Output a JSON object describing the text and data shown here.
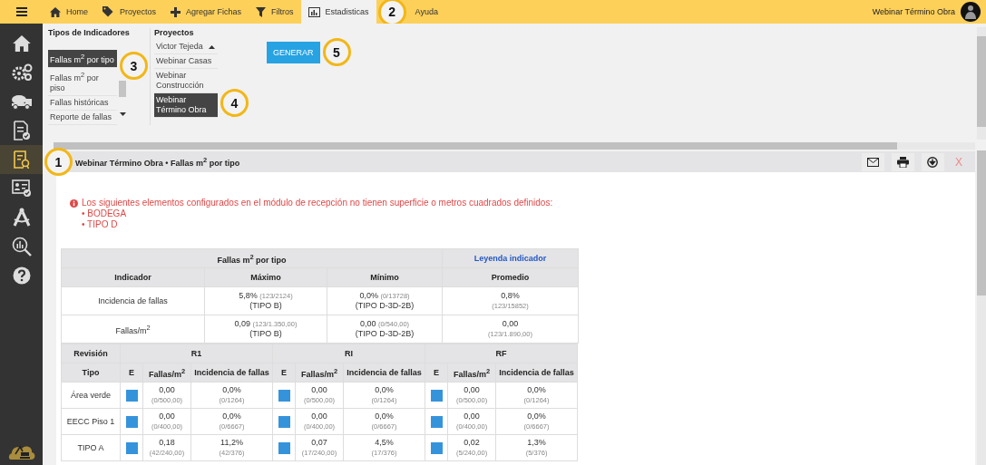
{
  "nav_tabs": [
    {
      "label": "Home",
      "kind": "home",
      "selected": false
    },
    {
      "label": "Proyectos",
      "kind": "tag",
      "selected": false
    },
    {
      "label": "Agregar Fichas",
      "kind": "plus",
      "selected": false
    },
    {
      "label": "Filtros",
      "kind": "filter",
      "selected": false
    },
    {
      "label": "Estadisticas",
      "kind": "chart",
      "selected": true
    },
    {
      "label": "Ayuda",
      "kind": "none",
      "selected": false
    }
  ],
  "user": {
    "name": "Webinar Término Obra"
  },
  "sidebar": {
    "items": [
      {
        "kind": "home",
        "selected": false
      },
      {
        "kind": "gears",
        "selected": false
      },
      {
        "kind": "truck",
        "selected": false
      },
      {
        "kind": "checklist",
        "selected": false
      },
      {
        "kind": "report",
        "selected": true
      },
      {
        "kind": "idcard",
        "selected": false
      },
      {
        "kind": "compass",
        "selected": false
      },
      {
        "kind": "search-chart",
        "selected": false
      },
      {
        "kind": "help",
        "selected": false
      }
    ]
  },
  "indicator_types": {
    "title": "Tipos de Indicadores",
    "items": [
      {
        "label": "Fallas m$^{2}$ por tipo",
        "selected": true
      },
      {
        "label": "Fallas m$^{2}$ por piso",
        "selected": false
      },
      {
        "label": "Fallas históricas",
        "selected": false
      },
      {
        "label": "Reporte de fallas",
        "selected": false
      }
    ]
  },
  "projects": {
    "title": "Proyectos",
    "items": [
      {
        "label": "Victor Tejeda",
        "selected": false
      },
      {
        "label": "Webinar Casas",
        "selected": false
      },
      {
        "label": "Webinar Construcción",
        "selected": false
      },
      {
        "label": "Webinar Término Obra",
        "selected": true
      }
    ]
  },
  "generate_button": {
    "label": "GENERAR"
  },
  "report": {
    "title": "Webinar Término Obra • Fallas m$^{2}$ por tipo",
    "actions": [
      {
        "kind": "mail"
      },
      {
        "kind": "print"
      },
      {
        "kind": "download"
      },
      {
        "kind": "close",
        "label": "X"
      }
    ],
    "warning": {
      "message": "Los siguientes elementos configurados en el módulo de recepción no tienen superficie o metros cuadrados definidos:",
      "items": [
        "• BODEGA",
        "• TIPO D"
      ]
    },
    "summary_table": {
      "title": "Fallas m$^{2}$ por tipo",
      "legend_link": "Leyenda indicador",
      "columns": [
        "Indicador",
        "Máximo",
        "Mínimo",
        "Promedio"
      ],
      "rows": [
        {
          "cells": [
            {
              "value": "Incidencia de fallas"
            },
            {
              "value": "5,8%",
              "detail": "(123/2124)",
              "type": "(TIPO B)"
            },
            {
              "value": "0,0%",
              "detail": "(0/13728)",
              "type": "(TIPO D-3D-2B)"
            },
            {
              "value": "0,8%",
              "detail": "(123/15852)"
            }
          ]
        },
        {
          "cells": [
            {
              "value": "Fallas/m$^{2}$"
            },
            {
              "value": "0,09",
              "detail": "(123/1.350,00)",
              "type": "(TIPO B)"
            },
            {
              "value": "0,00",
              "detail": "(0/540,00)",
              "type": "(TIPO D-3D-2B)"
            },
            {
              "value": "0,00",
              "detail": "(123/1.890,00)"
            }
          ]
        }
      ]
    },
    "detail_table": {
      "revision_label": "Revisión",
      "type_label": "Tipo",
      "groups": [
        {
          "name": "R1",
          "columns": [
            "E",
            "Fallas/m$^{2}$",
            "Incidencia de fallas"
          ]
        },
        {
          "name": "RI",
          "columns": [
            "E",
            "Fallas/m$^{2}$",
            "Incidencia de fallas"
          ]
        },
        {
          "name": "RF",
          "columns": [
            "E",
            "Fallas/m$^{2}$",
            "Incidencia de fallas"
          ]
        }
      ],
      "rows": [
        {
          "type": "Área verde",
          "groups": [
            {
              "color": "#3593dc",
              "fallas": "0,00",
              "fallas_detail": "(0/500,00)",
              "incidence": "0,0%",
              "incidence_detail": "(0/1264)"
            },
            {
              "color": "#3593dc",
              "fallas": "0,00",
              "fallas_detail": "(0/500,00)",
              "incidence": "0,0%",
              "incidence_detail": "(0/1264)"
            },
            {
              "color": "#3593dc",
              "fallas": "0,00",
              "fallas_detail": "(0/500,00)",
              "incidence": "0,0%",
              "incidence_detail": "(0/1264)"
            }
          ]
        },
        {
          "type": "EECC Piso 1",
          "groups": [
            {
              "color": "#3593dc",
              "fallas": "0,00",
              "fallas_detail": "(0/400,00)",
              "incidence": "0,0%",
              "incidence_detail": "(0/6667)"
            },
            {
              "color": "#3593dc",
              "fallas": "0,00",
              "fallas_detail": "(0/400,00)",
              "incidence": "0,0%",
              "incidence_detail": "(0/6667)"
            },
            {
              "color": "#3593dc",
              "fallas": "0,00",
              "fallas_detail": "(0/400,00)",
              "incidence": "0,0%",
              "incidence_detail": "(0/6667)"
            }
          ]
        },
        {
          "type": "TIPO A",
          "groups": [
            {
              "color": "#3593dc",
              "fallas": "0,18",
              "fallas_detail": "(42/240,00)",
              "incidence": "11,2%",
              "incidence_detail": "(42/376)"
            },
            {
              "color": "#3593dc",
              "fallas": "0,07",
              "fallas_detail": "(17/240,00)",
              "incidence": "4,5%",
              "incidence_detail": "(17/376)"
            },
            {
              "color": "#3593dc",
              "fallas": "0,02",
              "fallas_detail": "(5/240,00)",
              "incidence": "1,3%",
              "incidence_detail": "(5/376)"
            }
          ]
        }
      ]
    }
  },
  "callouts": [
    {
      "label": "1"
    },
    {
      "label": "2"
    },
    {
      "label": "3"
    },
    {
      "label": "4"
    },
    {
      "label": "5"
    }
  ]
}
